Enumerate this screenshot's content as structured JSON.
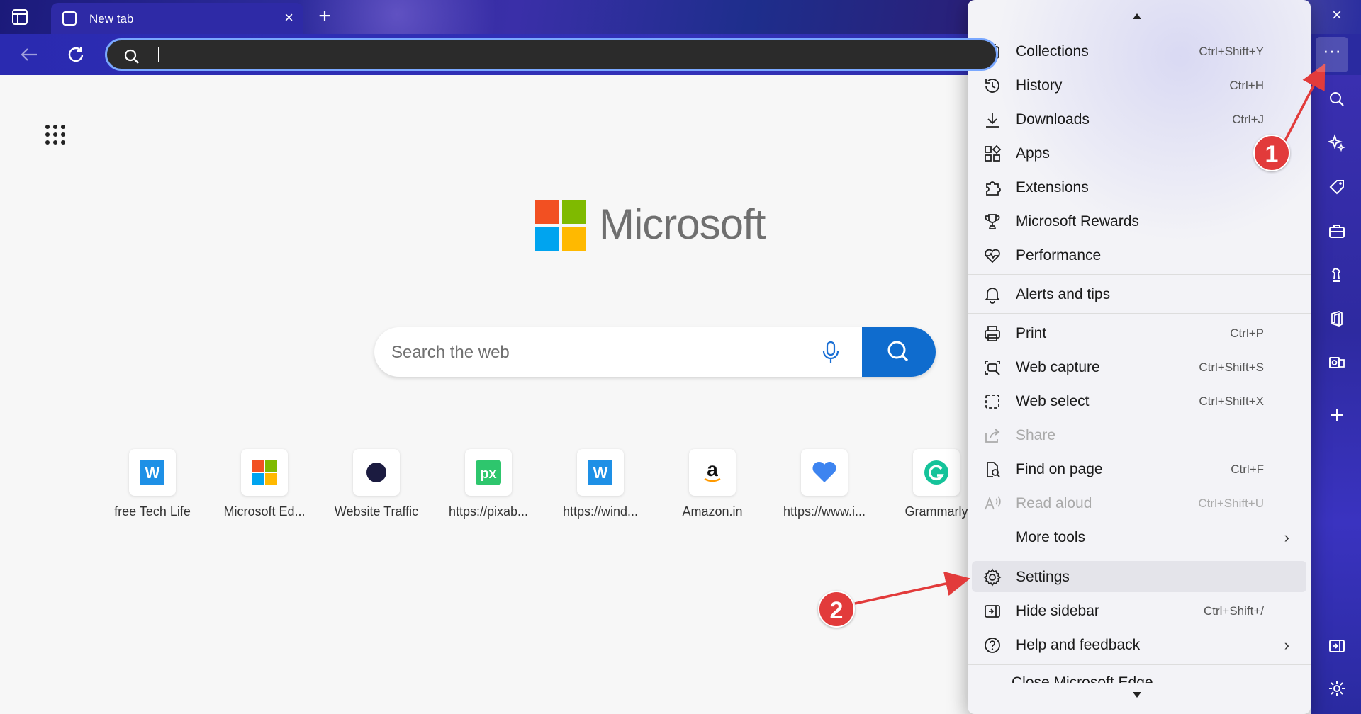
{
  "tab": {
    "title": "New tab"
  },
  "window": {
    "new_tab": "+",
    "close": "×"
  },
  "addressbar": {
    "value": ""
  },
  "toolbar": {
    "more_label": "···"
  },
  "page": {
    "brand": "Microsoft",
    "search_placeholder": "Search the web",
    "tiles": [
      {
        "label": "free Tech Life",
        "icon": "windows-report-icon"
      },
      {
        "label": "Microsoft Ed...",
        "icon": "microsoft-logo-icon"
      },
      {
        "label": "Website Traffic",
        "icon": "similarweb-icon"
      },
      {
        "label": "https://pixab...",
        "icon": "pixabay-icon"
      },
      {
        "label": "https://wind...",
        "icon": "windows-report-icon"
      },
      {
        "label": "Amazon.in",
        "icon": "amazon-icon"
      },
      {
        "label": "https://www.i...",
        "icon": "heart-icon"
      },
      {
        "label": "Grammarly",
        "icon": "grammarly-icon"
      }
    ]
  },
  "menu": {
    "items": [
      {
        "label": "Collections",
        "shortcut": "Ctrl+Shift+Y",
        "icon": "collections-icon"
      },
      {
        "label": "History",
        "shortcut": "Ctrl+H",
        "icon": "history-icon"
      },
      {
        "label": "Downloads",
        "shortcut": "Ctrl+J",
        "icon": "download-icon"
      },
      {
        "label": "Apps",
        "shortcut": "",
        "icon": "apps-icon"
      },
      {
        "label": "Extensions",
        "shortcut": "",
        "icon": "puzzle-icon"
      },
      {
        "label": "Microsoft Rewards",
        "shortcut": "",
        "icon": "trophy-icon"
      },
      {
        "label": "Performance",
        "shortcut": "",
        "icon": "heartbeat-icon"
      },
      {
        "label": "Alerts and tips",
        "shortcut": "",
        "icon": "bell-icon"
      },
      {
        "label": "Print",
        "shortcut": "Ctrl+P",
        "icon": "printer-icon"
      },
      {
        "label": "Web capture",
        "shortcut": "Ctrl+Shift+S",
        "icon": "web-capture-icon"
      },
      {
        "label": "Web select",
        "shortcut": "Ctrl+Shift+X",
        "icon": "web-select-icon"
      },
      {
        "label": "Share",
        "shortcut": "",
        "icon": "share-icon"
      },
      {
        "label": "Find on page",
        "shortcut": "Ctrl+F",
        "icon": "find-icon"
      },
      {
        "label": "Read aloud",
        "shortcut": "Ctrl+Shift+U",
        "icon": "read-aloud-icon"
      },
      {
        "label": "More tools",
        "shortcut": "",
        "icon": ""
      },
      {
        "label": "Settings",
        "shortcut": "",
        "icon": "gear-icon"
      },
      {
        "label": "Hide sidebar",
        "shortcut": "Ctrl+Shift+/",
        "icon": "hide-sidebar-icon"
      },
      {
        "label": "Help and feedback",
        "shortcut": "",
        "icon": "help-icon"
      },
      {
        "label": "Close Microsoft Edge",
        "shortcut": "",
        "icon": ""
      }
    ],
    "submenu_arrow": "›"
  },
  "annotations": {
    "step1": "1",
    "step2": "2",
    "color": "#e23b3b"
  },
  "colors": {
    "accent": "#0f6cce",
    "sidebar": "#2e2aa0"
  }
}
